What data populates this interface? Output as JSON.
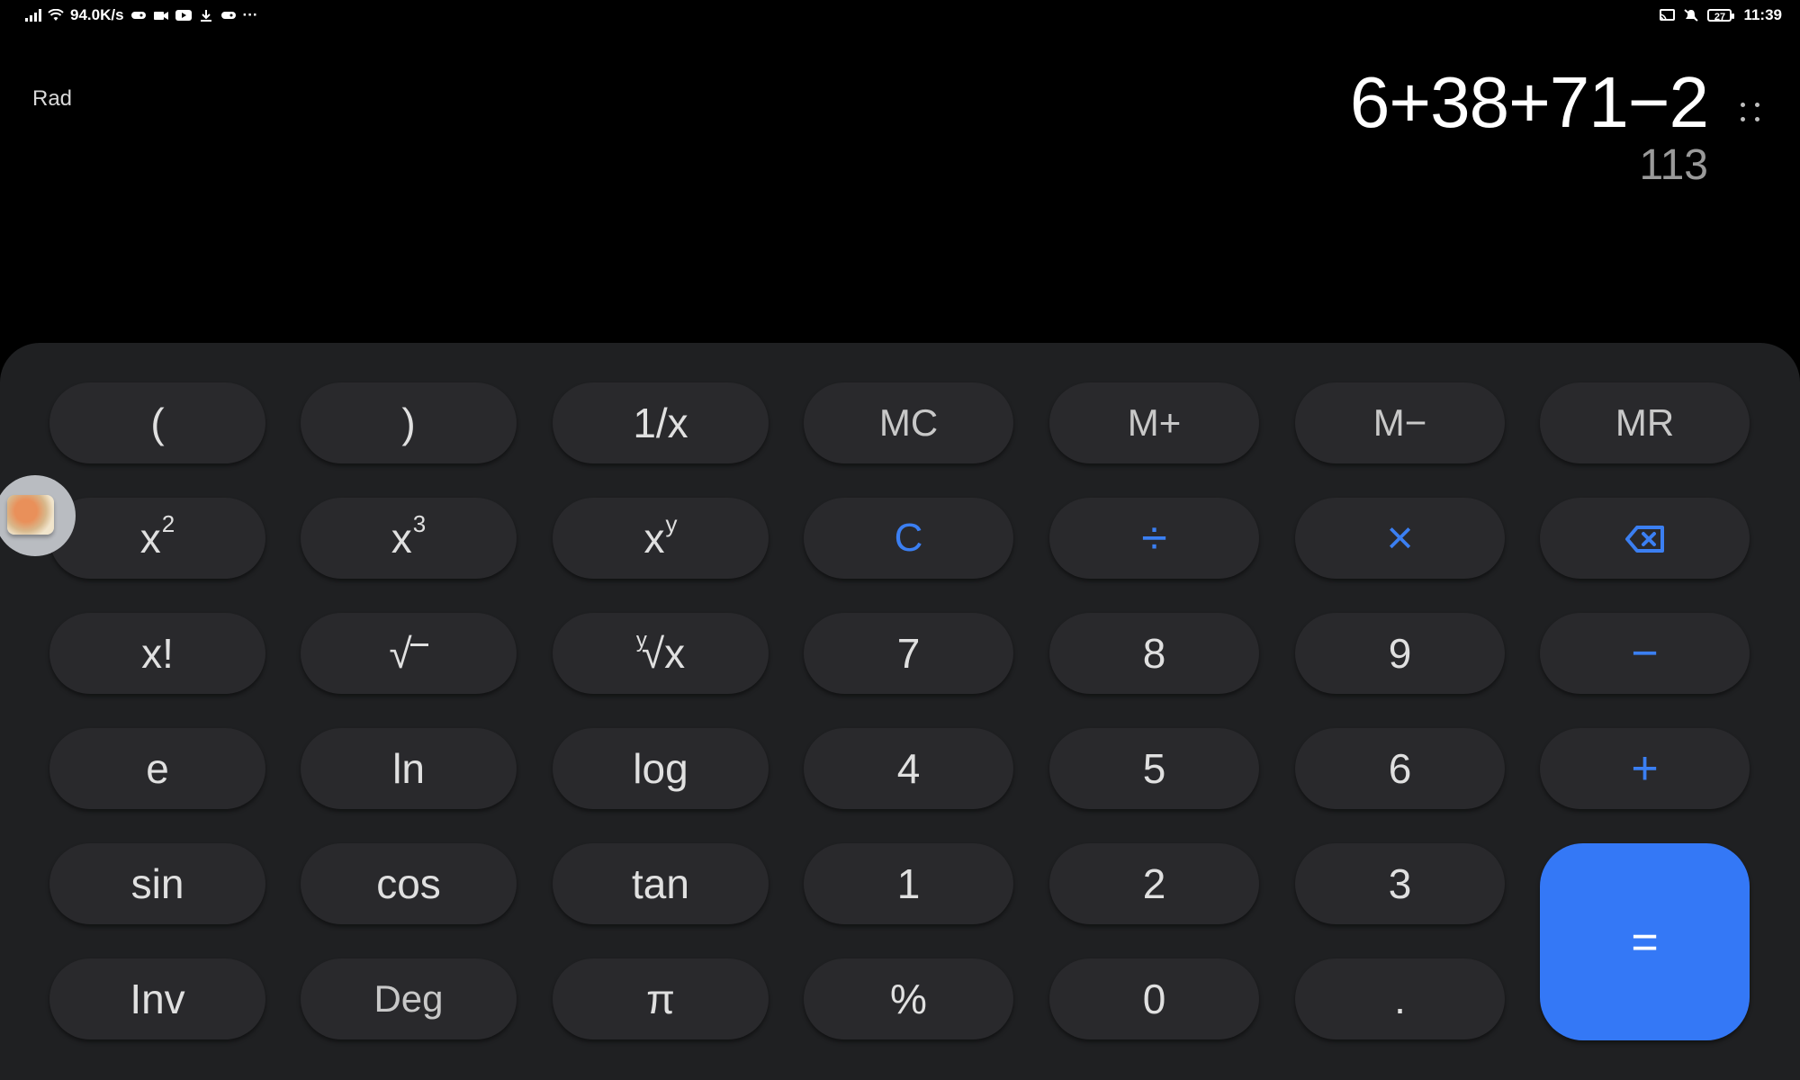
{
  "status_bar": {
    "net_speed": "94.0K/s",
    "more": "···",
    "battery": "27",
    "time": "11:39"
  },
  "display": {
    "mode": "Rad",
    "expression": "6+38+71−2",
    "result": "113"
  },
  "keys": {
    "open_paren": "(",
    "close_paren": ")",
    "reciprocal": "1/x",
    "mc": "MC",
    "m_plus": "M+",
    "m_minus": "M−",
    "mr": "MR",
    "x_base": "x",
    "sq_exp": "2",
    "cube_exp": "3",
    "pow_exp": "y",
    "clear": "C",
    "divide": "÷",
    "multiply": "×",
    "factorial": "x!",
    "sqrt": "√",
    "root_index": "y",
    "root_radical": "√x",
    "seven": "7",
    "eight": "8",
    "nine": "9",
    "minus": "−",
    "e": "e",
    "ln": "ln",
    "log": "log",
    "four": "4",
    "five": "5",
    "six": "6",
    "plus": "+",
    "sin": "sin",
    "cos": "cos",
    "tan": "tan",
    "one": "1",
    "two": "2",
    "three": "3",
    "equals": "=",
    "inv": "Inv",
    "deg": "Deg",
    "pi": "π",
    "percent": "%",
    "zero": "0",
    "dot": "."
  },
  "colors": {
    "accent": "#3478f6",
    "operator": "#3b7ff2",
    "key_bg": "#29292c",
    "panel_bg": "#1f2022"
  },
  "icons": {
    "backspace": "backspace-icon",
    "more_options": "more-dots-icon",
    "floating_avatar": "floating-avatar"
  }
}
